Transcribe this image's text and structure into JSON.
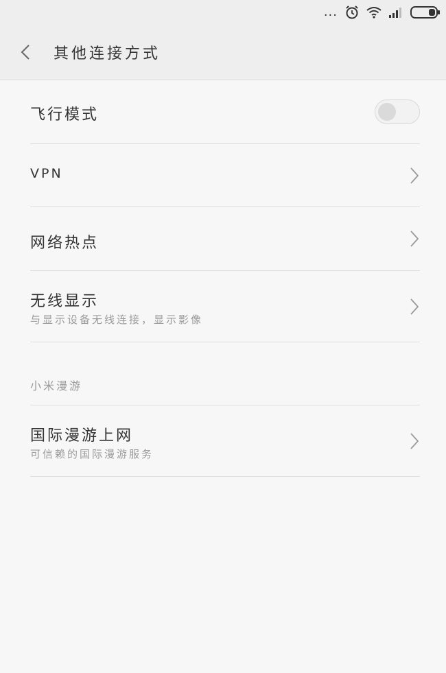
{
  "status_bar": {
    "dots": "...",
    "icons": [
      "alarm-icon",
      "wifi-icon",
      "signal-icon",
      "battery-icon"
    ]
  },
  "header": {
    "title": "其他连接方式",
    "back_icon": "chevron-left-icon"
  },
  "rows": {
    "airplane": {
      "title": "飞行模式",
      "toggle_on": false
    },
    "vpn": {
      "title": "VPN"
    },
    "hotspot": {
      "title": "网络热点"
    },
    "wireless_display": {
      "title": "无线显示",
      "subtitle": "与显示设备无线连接，显示影像"
    },
    "roaming": {
      "title": "国际漫游上网",
      "subtitle": "可信赖的国际漫游服务"
    }
  },
  "section": {
    "label": "小米漫游"
  },
  "colors": {
    "background": "#f7f7f7",
    "header": "#eeeeee",
    "text": "#333333",
    "secondary_text": "#9a9a9a",
    "divider": "#dedede"
  }
}
